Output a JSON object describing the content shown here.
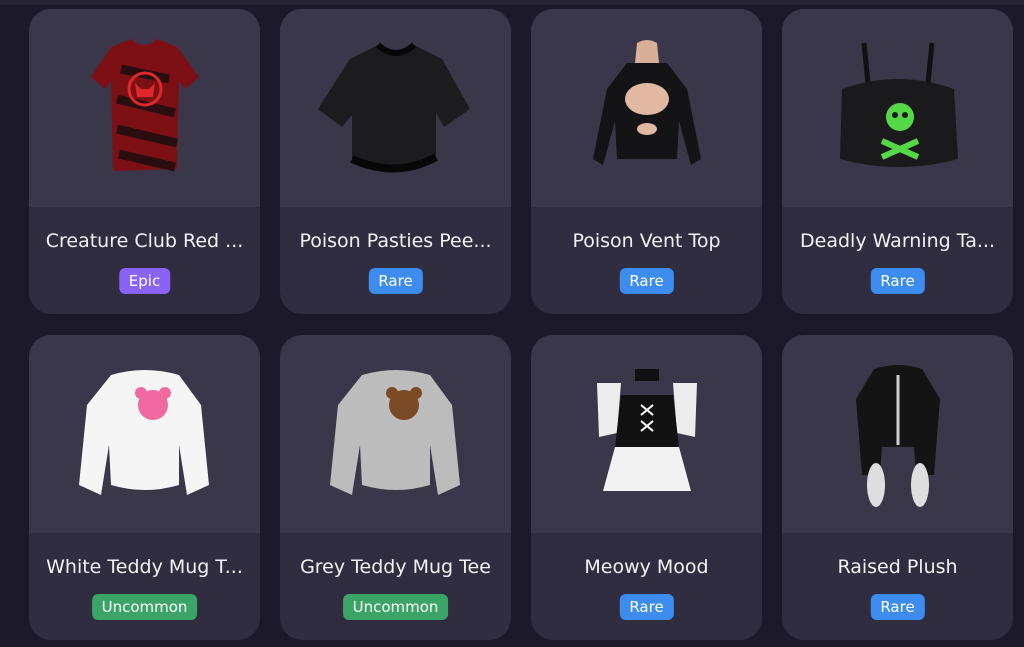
{
  "items": [
    {
      "title": "Creature Club Red ...",
      "rarity": "Epic",
      "icon": "shirt-icon"
    },
    {
      "title": "Poison Pasties Pee...",
      "rarity": "Rare",
      "icon": "shirt-icon"
    },
    {
      "title": "Poison Vent Top",
      "rarity": "Rare",
      "icon": "shirt-icon"
    },
    {
      "title": "Deadly Warning Ta...",
      "rarity": "Rare",
      "icon": "shirt-icon"
    },
    {
      "title": "White Teddy Mug T...",
      "rarity": "Uncommon",
      "icon": "shirt-icon"
    },
    {
      "title": "Grey Teddy Mug Tee",
      "rarity": "Uncommon",
      "icon": "shirt-icon"
    },
    {
      "title": "Meowy Mood",
      "rarity": "Rare",
      "icon": "shirt-icon"
    },
    {
      "title": "Raised Plush",
      "rarity": "Rare",
      "icon": "shirt-icon"
    }
  ]
}
